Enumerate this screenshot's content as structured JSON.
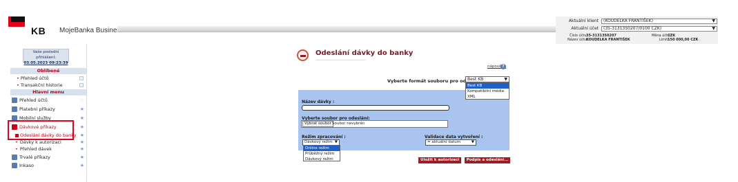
{
  "header": {
    "brand": "KB",
    "product": "MojeBanka Business"
  },
  "context": {
    "client_label": "Aktuální klient",
    "client_value": "(KOUDELKA FRANTIŠEK)",
    "account_label": "Aktuální účet",
    "account_value": "(35-3131350207/0100 CZK)",
    "account_no_label": "Číslo účtu:",
    "account_no": "35-3131350207",
    "account_name_label": "Název účtu:",
    "account_name": "KOUDELKA FRANTIŠEK",
    "currency_label": "Měna účtu:",
    "currency": "CZK",
    "limit_label": "Limit:",
    "limit": "150 000,00 CZK"
  },
  "sidebar": {
    "last_login_label": "Vaše poslední přihlášení:",
    "last_login": "03.05.2023 09:23:39",
    "favorites_title": "Oblíbené",
    "favorites": [
      "Přehled účtů",
      "Transakční historie"
    ],
    "main_menu_title": "Hlavní menu",
    "items": [
      {
        "label": "Přehled účtů"
      },
      {
        "label": "Platební příkazy"
      },
      {
        "label": "Mobilní služby"
      },
      {
        "label": "Dávkové příkazy"
      }
    ],
    "sub_items": [
      {
        "label": "Odeslání dávky do banky"
      },
      {
        "label": "Dávky k autorizaci"
      },
      {
        "label": "Přehled dávek"
      }
    ],
    "items_after": [
      {
        "label": "Trvalé příkazy"
      },
      {
        "label": "Inkaso"
      }
    ]
  },
  "main": {
    "title": "Odeslání dávky do banky",
    "help_link": "nápověda",
    "format_label": "Vyberte formát souboru pro odeslání",
    "format_selected": "Best KB",
    "format_options": [
      "Best KB",
      "Kompatibilní média",
      "XML"
    ],
    "batch_name_label": "Název dávky :",
    "file_label": "Vyberte soubor pro odeslání:",
    "file_button": "Vybrat soubor",
    "file_status": "Soubor nevybrán",
    "mode_label": "Režim zpracování :",
    "mode_selected": "Dávkový režim",
    "mode_options": [
      "Online režim",
      "Průběžný režim",
      "Dávkový režim"
    ],
    "validation_label": "Validace data vytvoření :",
    "validation_selected": "= aktuální datum",
    "save_button": "Uložit k autorizaci",
    "sign_button": "Podpis a odeslání..."
  },
  "colors": {
    "brand_red": "#e2001a",
    "panel_blue": "#a9c4ee",
    "button_red": "#a01c24",
    "title_color": "#7a1a2a"
  }
}
